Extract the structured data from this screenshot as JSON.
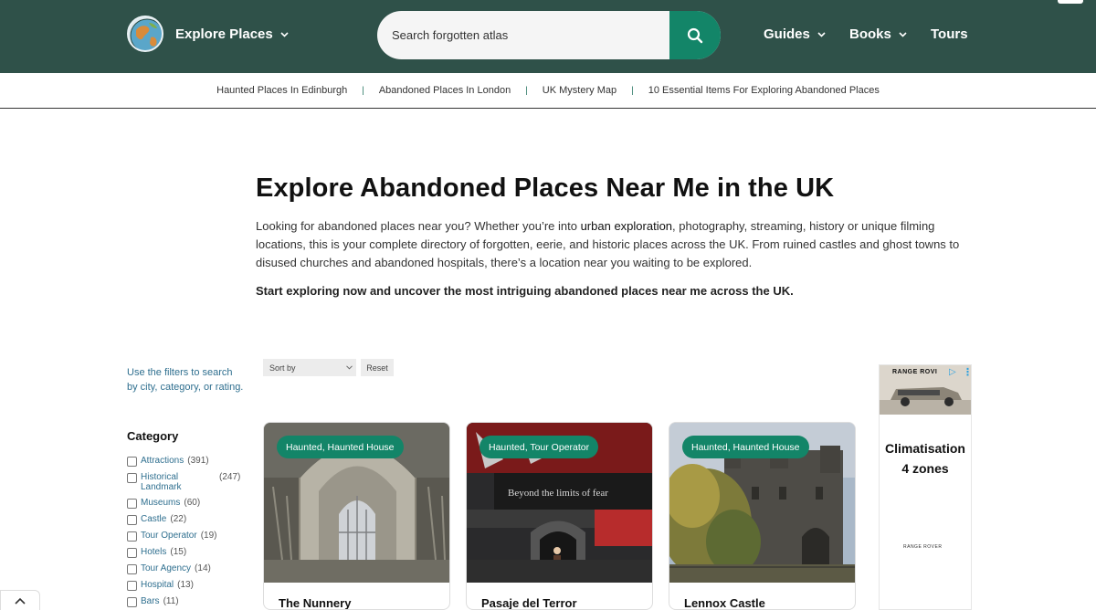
{
  "header": {
    "brand_label": "Explore Places",
    "search_placeholder": "Search forgotten atlas",
    "nav": [
      {
        "label": "Guides"
      },
      {
        "label": "Books"
      },
      {
        "label": "Tours"
      }
    ]
  },
  "subnav": {
    "links": [
      "Haunted Places In Edinburgh",
      "Abandoned Places In London",
      "UK Mystery Map",
      "10 Essential Items For Exploring Abandoned Places"
    ],
    "separator": "|"
  },
  "hero": {
    "title": "Explore Abandoned Places Near Me in the UK",
    "intro_before": "Looking for abandoned places near you? Whether you’re into ",
    "intro_link": "urban exploration",
    "intro_after": ", photography, streaming, history or unique filming locations, this is your complete directory of forgotten, eerie, and historic places across the UK. From ruined castles and ghost towns to disused churches and abandoned hospitals, there’s a location near you waiting to be explored.",
    "cta": "Start exploring now and uncover the most intriguing abandoned places near me across the UK."
  },
  "filters": {
    "hint": "Use the filters to search by city, category, or rating.",
    "category_heading": "Category",
    "categories": [
      {
        "label": "Attractions",
        "count": "(391)"
      },
      {
        "label": "Historical Landmark",
        "count": "(247)"
      },
      {
        "label": "Museums",
        "count": "(60)"
      },
      {
        "label": "Castle",
        "count": "(22)"
      },
      {
        "label": "Tour Operator",
        "count": "(19)"
      },
      {
        "label": "Hotels",
        "count": "(15)"
      },
      {
        "label": "Tour Agency",
        "count": "(14)"
      },
      {
        "label": "Hospital",
        "count": "(13)"
      },
      {
        "label": "Bars",
        "count": "(11)"
      }
    ]
  },
  "sort": {
    "label": "Sort by",
    "reset_label": "Reset"
  },
  "cards": [
    {
      "badge": "Haunted, Haunted House",
      "title": "The Nunnery"
    },
    {
      "badge": "Haunted, Tour Operator",
      "title": "Pasaje del Terror",
      "sign_text": "Beyond the limits of fear"
    },
    {
      "badge": "Haunted, Haunted House",
      "title": "Lennox Castle"
    }
  ],
  "ad": {
    "brand_top": "RANGE ROVI",
    "headline_line1": "Climatisation",
    "headline_line2": "4 zones",
    "brand_bottom": "RANGE ROVER"
  },
  "colors": {
    "header_bg": "#2f5149",
    "accent": "#138568",
    "link_blue": "#2f6f8f"
  },
  "icons": {
    "brand": "globe-icon",
    "search": "search-icon",
    "dropdown": "chevron-down-icon",
    "to_top": "chevron-up-icon"
  }
}
